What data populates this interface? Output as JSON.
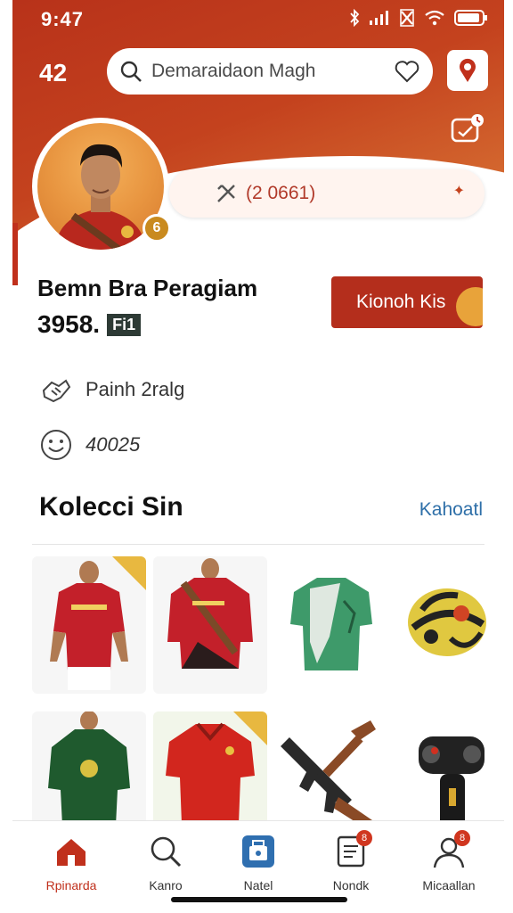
{
  "status_bar": {
    "time": "9:47"
  },
  "header": {
    "count": "42",
    "search_placeholder": "Demaraidaon Magh",
    "stat_value": "(2 0661)"
  },
  "profile": {
    "name": "Bemn Bra Peragiam",
    "number": "3958.",
    "number_tag": "Fi1",
    "follow_button": "Kionoh Kis",
    "info": [
      {
        "icon": "handshake-icon",
        "text": "Painh 2ralg"
      },
      {
        "icon": "emoji-icon",
        "text": "40025"
      }
    ]
  },
  "collection": {
    "title": "Kolecci Sin",
    "see_all": "Kahoatl",
    "items": [
      {
        "name": "red-jersey-player"
      },
      {
        "name": "red-black-jersey"
      },
      {
        "name": "green-white-shirt"
      },
      {
        "name": "yellow-helmet"
      },
      {
        "name": "green-jersey"
      },
      {
        "name": "red-jersey"
      },
      {
        "name": "rifle"
      },
      {
        "name": "camera-rig"
      }
    ]
  },
  "nav": {
    "items": [
      {
        "label": "Rpinarda",
        "icon": "home-icon",
        "active": true
      },
      {
        "label": "Kanro",
        "icon": "search-icon"
      },
      {
        "label": "Natel",
        "icon": "bag-icon"
      },
      {
        "label": "Nondk",
        "icon": "notes-icon",
        "badge": "8"
      },
      {
        "label": "Micaallan",
        "icon": "profile-icon",
        "badge": "8"
      }
    ]
  },
  "colors": {
    "primary": "#c0301c",
    "accent": "#e8a33a",
    "link": "#2e6fa8"
  }
}
